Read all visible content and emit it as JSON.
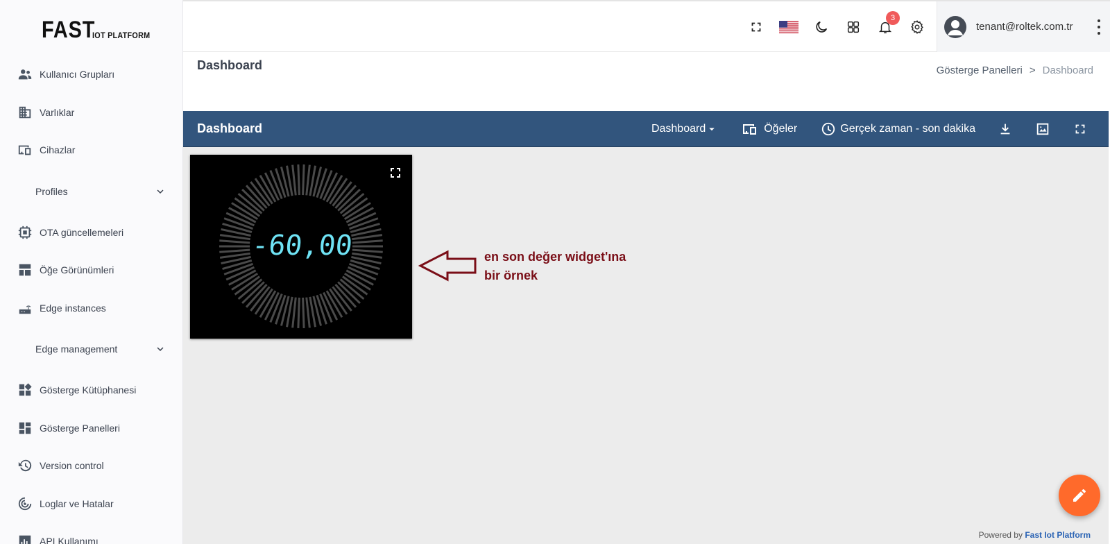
{
  "logo": {
    "main": "FAST",
    "sub": "IOT PLATFORM"
  },
  "sidebar": {
    "items": [
      {
        "label": "Kullanıcı Grupları",
        "icon": "user-group-icon"
      },
      {
        "label": "Varlıklar",
        "icon": "building-icon"
      },
      {
        "label": "Cihazlar",
        "icon": "devices-icon"
      },
      {
        "label": "Profiles",
        "type": "group"
      },
      {
        "label": "OTA güncellemeleri",
        "icon": "chip-icon"
      },
      {
        "label": "Öğe Görünümleri",
        "icon": "layout-icon"
      },
      {
        "label": "Edge instances",
        "icon": "router-icon"
      },
      {
        "label": "Edge management",
        "type": "group"
      },
      {
        "label": "Gösterge Kütüphanesi",
        "icon": "widget-library-icon"
      },
      {
        "label": "Gösterge Panelleri",
        "icon": "dashboard-icon"
      },
      {
        "label": "Version control",
        "icon": "history-icon"
      },
      {
        "label": "Loglar ve Hatalar",
        "icon": "radar-icon"
      },
      {
        "label": "API Kullanımı",
        "icon": "bar-chart-icon"
      }
    ]
  },
  "topbar": {
    "notification_count": "3",
    "user_email": "tenant@roltek.com.tr"
  },
  "page": {
    "title": "Dashboard",
    "breadcrumb": {
      "parent": "Gösterge Panelleri",
      "separator": ">",
      "current": "Dashboard"
    }
  },
  "toolbar": {
    "title": "Dashboard",
    "dashboard_select": "Dashboard",
    "entities_label": "Öğeler",
    "time_label": "Gerçek zaman - son dakika"
  },
  "widget": {
    "value": "-60,00",
    "value_color": "#6fe3f5"
  },
  "annotation": {
    "line1": "en son değer widget'ına",
    "line2": "bir örnek",
    "color": "#7a0e17"
  },
  "footer": {
    "powered_prefix": "Powered by",
    "powered_brand": "Fast Iot Platform"
  },
  "colors": {
    "toolbar_bg": "#32557d",
    "fab_bg": "#ff6a2b",
    "badge_bg": "#f05a5a"
  }
}
